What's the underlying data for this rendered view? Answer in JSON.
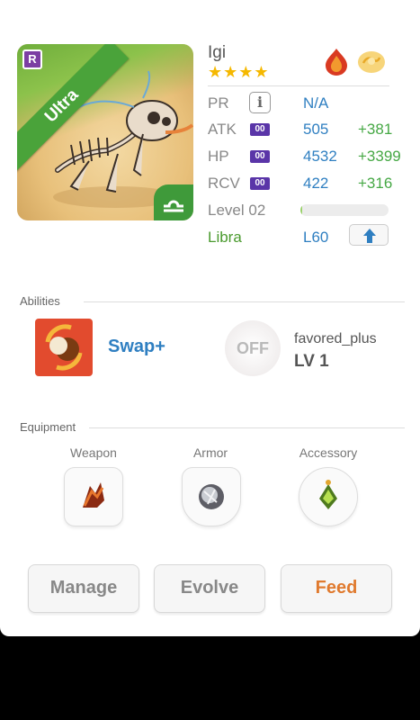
{
  "monster": {
    "rarity": "Ultra",
    "rarity_badge": "R",
    "name": "Igi",
    "stars": "★★★★",
    "elements": [
      "fire-icon",
      "light-icon"
    ]
  },
  "stats": {
    "pr_label": "PR",
    "pr_info": "i",
    "pr_value": "N/A",
    "atk_label": "ATK",
    "atk_badge": "00",
    "atk_value": "505",
    "atk_plus": "+381",
    "hp_label": "HP",
    "hp_badge": "00",
    "hp_value": "4532",
    "hp_plus": "+3399",
    "rcv_label": "RCV",
    "rcv_badge": "00",
    "rcv_value": "422",
    "rcv_plus": "+316",
    "level_label": "Level 02",
    "exp_progress": 0.02,
    "sign_label": "Libra",
    "max_level": "L60"
  },
  "abilities": {
    "header": "Abilities",
    "primary_name": "Swap+",
    "secondary_state": "OFF",
    "secondary_name": "favored_plus",
    "secondary_level": "LV 1"
  },
  "equipment": {
    "header": "Equipment",
    "weapon_label": "Weapon",
    "armor_label": "Armor",
    "accessory_label": "Accessory"
  },
  "buttons": {
    "manage": "Manage",
    "evolve": "Evolve",
    "feed": "Feed"
  },
  "colors": {
    "stat_value": "#2f7fc1",
    "stat_plus": "#46a845",
    "feed_accent": "#e07a2e",
    "ultra_ribbon": "#4aa33a"
  }
}
